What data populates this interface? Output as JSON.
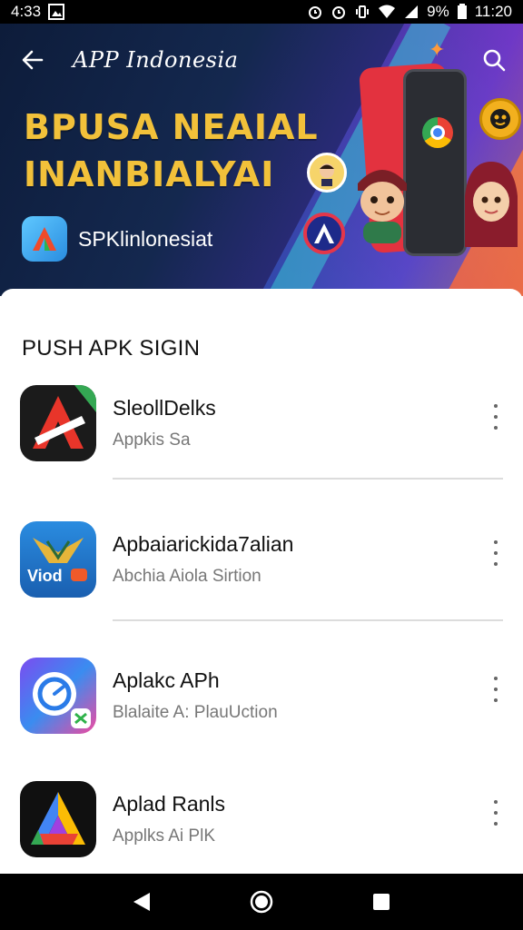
{
  "status_bar": {
    "time_left": "4:33",
    "battery": "9%",
    "time_right": "11:20"
  },
  "header": {
    "title": "APP Indonesia",
    "back_icon": "arrow-left-icon",
    "search_icon": "search-icon"
  },
  "banner": {
    "headline_line1": "BPUSA NEAIAL",
    "headline_line2": "INANBIALYAI",
    "brand_name": "SPKlinlonesiat",
    "accent_color": "#f2c13a"
  },
  "section": {
    "title": "PUSH APK SIGIN"
  },
  "apps": [
    {
      "name": "SleollDelks",
      "subtitle": "Appkis Sa",
      "icon": "red-a-logo-icon"
    },
    {
      "name": "Apbaiarickida7alian",
      "subtitle": "Abchia Aiola Sirtion",
      "icon": "viod-logo-icon",
      "icon_label": "Viod"
    },
    {
      "name": "Aplakc APh",
      "subtitle": "Blalaite A: PlauUction",
      "icon": "blue-ring-logo-icon"
    },
    {
      "name": "Aplad Ranls",
      "subtitle": "Applks Ai PlK",
      "icon": "rainbow-a-logo-icon"
    }
  ],
  "nav": {
    "back": "triangle-back-icon",
    "home": "circle-home-icon",
    "recents": "square-recents-icon"
  }
}
